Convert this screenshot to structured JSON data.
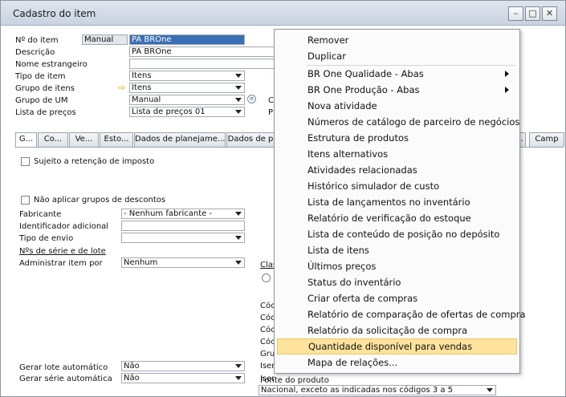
{
  "window": {
    "title": "Cadastro do item",
    "controls": [
      "minimize",
      "maximize",
      "close"
    ]
  },
  "header": {
    "item_no_label": "Nº do item",
    "item_no_mode": "Manual",
    "item_no_value": "PA BROne",
    "description_label": "Descrição",
    "description_value": "PA BROne",
    "foreign_name_label": "Nome estrangeiro",
    "foreign_name_value": "",
    "item_type_label": "Tipo de item",
    "item_type_value": "Itens",
    "item_group_label": "Grupo de itens",
    "item_group_value": "Itens",
    "uom_group_label": "Grupo de UM",
    "uom_group_value": "Manual",
    "price_list_label": "Lista de preços",
    "price_list_value": "Lista de preços 01",
    "partial_c": "C",
    "partial_p": "P"
  },
  "tabs": [
    {
      "label": "G..."
    },
    {
      "label": "Co..."
    },
    {
      "label": "Ve..."
    },
    {
      "label": "Esto..."
    },
    {
      "label": "Dados de planejame..."
    },
    {
      "label": "Dados de p"
    },
    {
      "label": "..."
    },
    {
      "label": "Camp"
    }
  ],
  "general": {
    "withholding_tax_label": "Sujeito a retenção de imposto",
    "no_discount_groups_label": "Não aplicar grupos de descontos",
    "manufacturer_label": "Fabricante",
    "manufacturer_value": "- Nenhum fabricante -",
    "additional_id_label": "Identificador adicional",
    "additional_id_value": "",
    "shipping_type_label": "Tipo de envio",
    "shipping_type_value": "",
    "serial_batch_header": "Nºs de série e de lote",
    "manage_item_by_label": "Administrar item por",
    "manage_item_by_value": "Nenhum",
    "auto_batch_label": "Gerar lote automático",
    "auto_batch_value": "Não",
    "auto_serial_label": "Gerar série automática",
    "auto_serial_value": "Não",
    "partial_clas": "Clas",
    "partial_cod_rows": [
      "Cóc",
      "Cóc",
      "Cóc",
      "Cóc",
      "Cóc"
    ],
    "partial_gru": "Gru",
    "partial_ise": "Iser",
    "partial_ise2": "Iser",
    "product_source_label": "Fonte do produto",
    "product_source_value": "Nacional, exceto as indicadas nos códigos 3 a 5"
  },
  "context_menu": {
    "items": [
      {
        "label": "Remover",
        "submenu": false,
        "hover": false
      },
      {
        "label": "Duplicar",
        "submenu": false,
        "hover": false
      },
      {
        "label": "BR One Qualidade - Abas",
        "submenu": true,
        "hover": false
      },
      {
        "label": "BR One Produção - Abas",
        "submenu": true,
        "hover": false
      },
      {
        "label": "Nova atividade",
        "submenu": false,
        "hover": false
      },
      {
        "label": "Números de catálogo de parceiro de negócios",
        "submenu": false,
        "hover": false
      },
      {
        "label": "Estrutura de produtos",
        "submenu": false,
        "hover": false
      },
      {
        "label": "Itens alternativos",
        "submenu": false,
        "hover": false
      },
      {
        "label": "Atividades relacionadas",
        "submenu": false,
        "hover": false
      },
      {
        "label": "Histórico simulador de custo",
        "submenu": false,
        "hover": false
      },
      {
        "label": "Lista de lançamentos no inventário",
        "submenu": false,
        "hover": false
      },
      {
        "label": "Relatório de verificação do estoque",
        "submenu": false,
        "hover": false
      },
      {
        "label": "Lista de conteúdo de posição no depósito",
        "submenu": false,
        "hover": false
      },
      {
        "label": "Lista de itens",
        "submenu": false,
        "hover": false
      },
      {
        "label": "Últimos preços",
        "submenu": false,
        "hover": false
      },
      {
        "label": "Status do inventário",
        "submenu": false,
        "hover": false
      },
      {
        "label": "Criar oferta de compras",
        "submenu": false,
        "hover": false
      },
      {
        "label": "Relatório de comparação de ofertas de compra",
        "submenu": false,
        "hover": false
      },
      {
        "label": "Relatório da solicitação de compra",
        "submenu": false,
        "hover": false
      },
      {
        "label": "Quantidade disponível para vendas",
        "submenu": false,
        "hover": true
      },
      {
        "label": "Mapa de relações...",
        "submenu": false,
        "hover": false
      }
    ]
  },
  "colors": {
    "menu_hover": "#fde39d",
    "link_arrow": "#e9a400"
  }
}
